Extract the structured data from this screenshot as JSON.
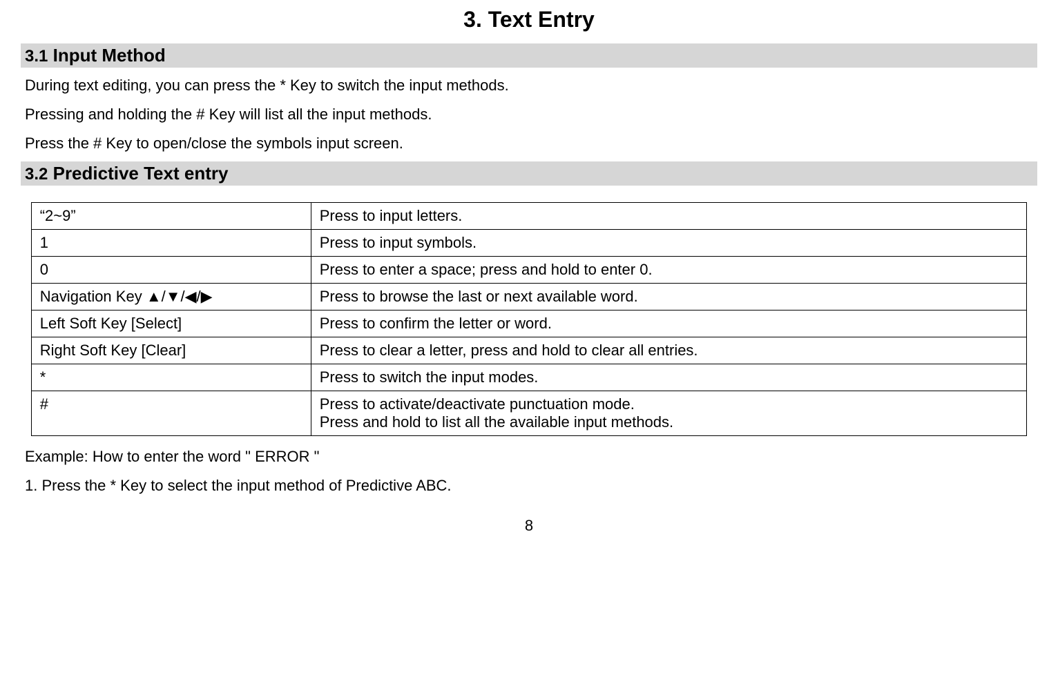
{
  "title": "3.   Text Entry",
  "section1": {
    "num": "3.1",
    "label": " Input Method"
  },
  "p1": "During text editing, you can press the * Key to switch the input methods.",
  "p2": "Pressing and holding the # Key will list all the input methods.",
  "p3": "Press the # Key to open/close the symbols input screen.",
  "section2": {
    "num": "3.2",
    "label": " Predictive Text entry"
  },
  "table": {
    "rows": [
      {
        "key": "“2~9”",
        "desc": "Press to input letters."
      },
      {
        "key": "1",
        "desc": "Press to input symbols."
      },
      {
        "key": "0",
        "desc": "Press to enter a space; press and hold to enter 0."
      },
      {
        "key_prefix": "Navigation Key  ",
        "nav": "▲/▼/◀/▶",
        "desc": "Press to browse the last or next available word."
      },
      {
        "key": "Left Soft Key [Select]",
        "desc": "Press to confirm the letter or word."
      },
      {
        "key": "Right Soft Key [Clear]",
        "desc": "Press to clear a letter, press and hold to clear all entries."
      },
      {
        "key": "*",
        "desc": "Press to switch the input modes."
      },
      {
        "key": "#",
        "desc": "Press to activate/deactivate punctuation mode.",
        "desc2": "Press and hold to list all the available input methods."
      }
    ]
  },
  "example_heading": "Example: How to enter the word \" ERROR \"",
  "example_step1": "1. Press the * Key to select the input method of Predictive ABC.",
  "page_number": "8"
}
